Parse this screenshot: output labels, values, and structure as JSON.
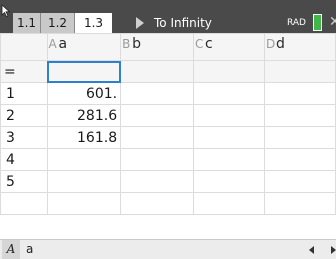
{
  "tabs": [
    {
      "label": "1.1",
      "active": false
    },
    {
      "label": "1.2",
      "active": false
    },
    {
      "label": "1.3",
      "active": true
    }
  ],
  "document_title": "To Infinity",
  "angle_mode": "RAD",
  "columns": [
    {
      "letter": "A",
      "name": "a"
    },
    {
      "letter": "B",
      "name": "b"
    },
    {
      "letter": "C",
      "name": "c"
    },
    {
      "letter": "D",
      "name": "d"
    }
  ],
  "formula_row_label": "=",
  "rows": [
    {
      "num": "1",
      "a": "601."
    },
    {
      "num": "2",
      "a": "281.6"
    },
    {
      "num": "3",
      "a": "161.8"
    },
    {
      "num": "4",
      "a": ""
    },
    {
      "num": "5",
      "a": ""
    }
  ],
  "entry_line": {
    "cell_ref": "A",
    "value": "a"
  },
  "icons": {
    "cursor": "cursor-arrow-icon",
    "play": "play-icon",
    "battery": "battery-icon",
    "close": "close-icon",
    "scroll_left": "arrow-left-icon",
    "scroll_right": "arrow-right-icon"
  },
  "colors": {
    "topbar": "#4a4a4a",
    "selection": "#2f7fcf",
    "battery": "#41b649"
  }
}
